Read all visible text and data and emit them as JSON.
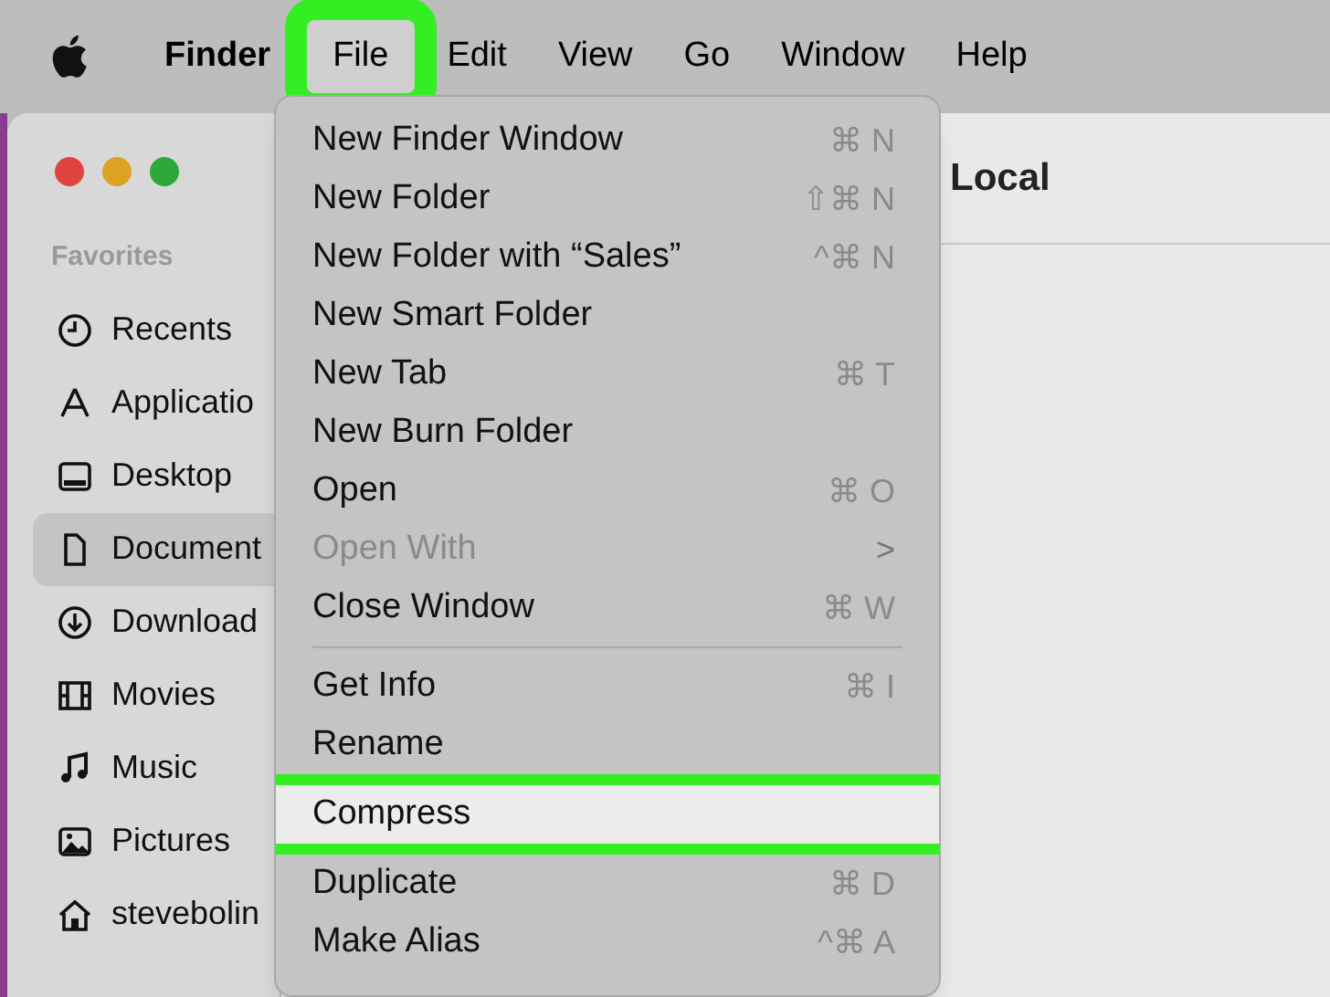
{
  "menu_bar": [
    {
      "label": "Finder",
      "kind": "app",
      "selected": false,
      "highlighted": false
    },
    {
      "label": "File",
      "kind": "menu",
      "selected": true,
      "highlighted": true
    },
    {
      "label": "Edit",
      "kind": "menu",
      "selected": false,
      "highlighted": false
    },
    {
      "label": "View",
      "kind": "menu",
      "selected": false,
      "highlighted": false
    },
    {
      "label": "Go",
      "kind": "menu",
      "selected": false,
      "highlighted": false
    },
    {
      "label": "Window",
      "kind": "menu",
      "selected": false,
      "highlighted": false
    },
    {
      "label": "Help",
      "kind": "menu",
      "selected": false,
      "highlighted": false
    }
  ],
  "window": {
    "title": "Local"
  },
  "sidebar": {
    "heading": "Favorites",
    "items": [
      {
        "label": "Recents",
        "selected": false
      },
      {
        "label": "Applicatio",
        "selected": false
      },
      {
        "label": "Desktop",
        "selected": false
      },
      {
        "label": "Document",
        "selected": true
      },
      {
        "label": "Download",
        "selected": false
      },
      {
        "label": "Movies",
        "selected": false
      },
      {
        "label": "Music",
        "selected": false
      },
      {
        "label": "Pictures",
        "selected": false
      },
      {
        "label": "stevebolin",
        "selected": false
      }
    ]
  },
  "file_menu": {
    "items": [
      {
        "label": "New Finder Window",
        "shortcut": "⌘ N",
        "disabled": false,
        "highlighted": false
      },
      {
        "label": "New Folder",
        "shortcut": "⇧⌘ N",
        "disabled": false,
        "highlighted": false
      },
      {
        "label": "New Folder with “Sales”",
        "shortcut": "^⌘ N",
        "disabled": false,
        "highlighted": false
      },
      {
        "label": "New Smart Folder",
        "disabled": false,
        "highlighted": false
      },
      {
        "label": "New Tab",
        "shortcut": "⌘ T",
        "disabled": false,
        "highlighted": false
      },
      {
        "label": "New Burn Folder",
        "disabled": false,
        "highlighted": false
      },
      {
        "label": "Open",
        "shortcut": "⌘ O",
        "disabled": false,
        "highlighted": false
      },
      {
        "label": "Open With",
        "shortcut": ">",
        "disabled": true,
        "highlighted": false
      },
      {
        "label": "Close Window",
        "shortcut": "⌘ W",
        "disabled": false,
        "highlighted": false,
        "separator_after": true
      },
      {
        "label": "Get Info",
        "shortcut": "⌘ I",
        "disabled": false,
        "highlighted": false
      },
      {
        "label": "Rename",
        "disabled": false,
        "highlighted": false
      },
      {
        "label": "Compress",
        "disabled": false,
        "highlighted": true
      },
      {
        "label": "Duplicate",
        "shortcut": "⌘ D",
        "disabled": false,
        "highlighted": false
      },
      {
        "label": "Make Alias",
        "shortcut": "^⌘ A",
        "disabled": false,
        "highlighted": false
      }
    ]
  }
}
